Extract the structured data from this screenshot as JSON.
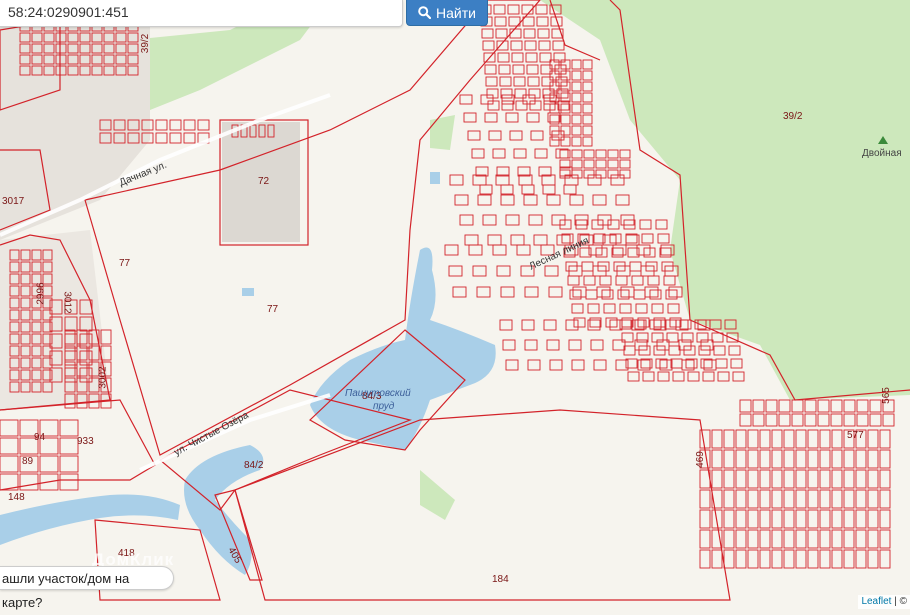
{
  "search": {
    "value": "58:24:0290901:451",
    "button_label": "Найти"
  },
  "map": {
    "parcel_labels": [
      "39/2",
      "39/2",
      "72",
      "77",
      "77",
      "84/3",
      "84/2",
      "3017",
      "2996",
      "3012",
      "3002",
      "933",
      "94",
      "89",
      "148",
      "418",
      "405",
      "184",
      "469",
      "577",
      "565"
    ],
    "water_label_line1": "Пашутовский",
    "water_label_line2": "пруд",
    "place_name": "Двойная",
    "streets": [
      "Дачная ул.",
      "ул. Чистые Озёра",
      "Лесная линия"
    ]
  },
  "bottom_message": "ашли участок/дом на карте?",
  "watermark": "ДомКлик",
  "attribution": {
    "leaflet": "Leaflet",
    "suffix": "| ©"
  },
  "colors": {
    "parcel_line": "#d3232a",
    "forest": "#c9e6b7",
    "water": "#a9cfe8",
    "button": "#3c7fc4"
  }
}
